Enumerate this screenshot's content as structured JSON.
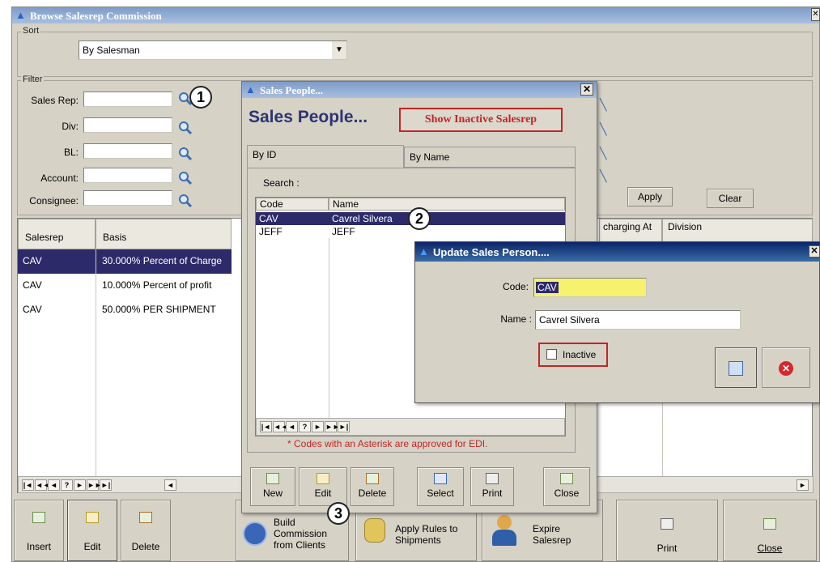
{
  "main": {
    "title": "Browse Salesrep Commission",
    "sort": {
      "legend": "Sort",
      "value": "By Salesman"
    },
    "filter": {
      "legend": "Filter",
      "labels": [
        "Sales Rep:",
        "Div:",
        "BL:",
        "Account:",
        "Consignee:"
      ],
      "apply": "Apply",
      "clear": "Clear"
    },
    "grid": {
      "headers": [
        "Salesrep",
        "Basis"
      ],
      "rows": [
        {
          "rep": "CAV",
          "basis": "30.000% Percent of Charge"
        },
        {
          "rep": "CAV",
          "basis": "10.000% Percent of profit"
        },
        {
          "rep": "CAV",
          "basis": "50.000% PER SHIPMENT"
        }
      ],
      "right_headers": [
        "charging At",
        "Division"
      ]
    },
    "nav_buttons": [
      "|◄",
      "◄◄",
      "◄",
      "?",
      "►",
      "►►",
      "►|"
    ],
    "toolbar": {
      "insert": "Insert",
      "edit": "Edit",
      "delete": "Delete",
      "build": "Build Commission from Clients",
      "apply_rules": "Apply Rules to Shipments",
      "expire": "Expire Salesrep",
      "print": "Print",
      "close": "Close"
    }
  },
  "sales_people": {
    "window_title": "Sales People...",
    "heading": "Sales People...",
    "show_inactive": "Show Inactive Salesrep",
    "tabs": [
      "By ID",
      "By Name"
    ],
    "search_label": "Search :",
    "list_headers": [
      "Code",
      "Name"
    ],
    "rows": [
      {
        "code": "CAV",
        "name": "Cavrel Silvera"
      },
      {
        "code": "JEFF",
        "name": "JEFF"
      }
    ],
    "note": "* Codes with an Asterisk are approved for EDI.",
    "buttons": [
      "New",
      "Edit",
      "Delete",
      "Select",
      "Print",
      "Close"
    ]
  },
  "update_dialog": {
    "title": "Update Sales Person....",
    "code_label": "Code:",
    "code_value": "CAV",
    "name_label": "Name :",
    "name_value": "Cavrel Silvera",
    "inactive_label": "Inactive"
  },
  "callouts": [
    "1",
    "2",
    "3"
  ],
  "colors": {
    "selected_row": "#2d2a6a",
    "highlight": "#c22525",
    "code_field": "#f7f26e"
  }
}
